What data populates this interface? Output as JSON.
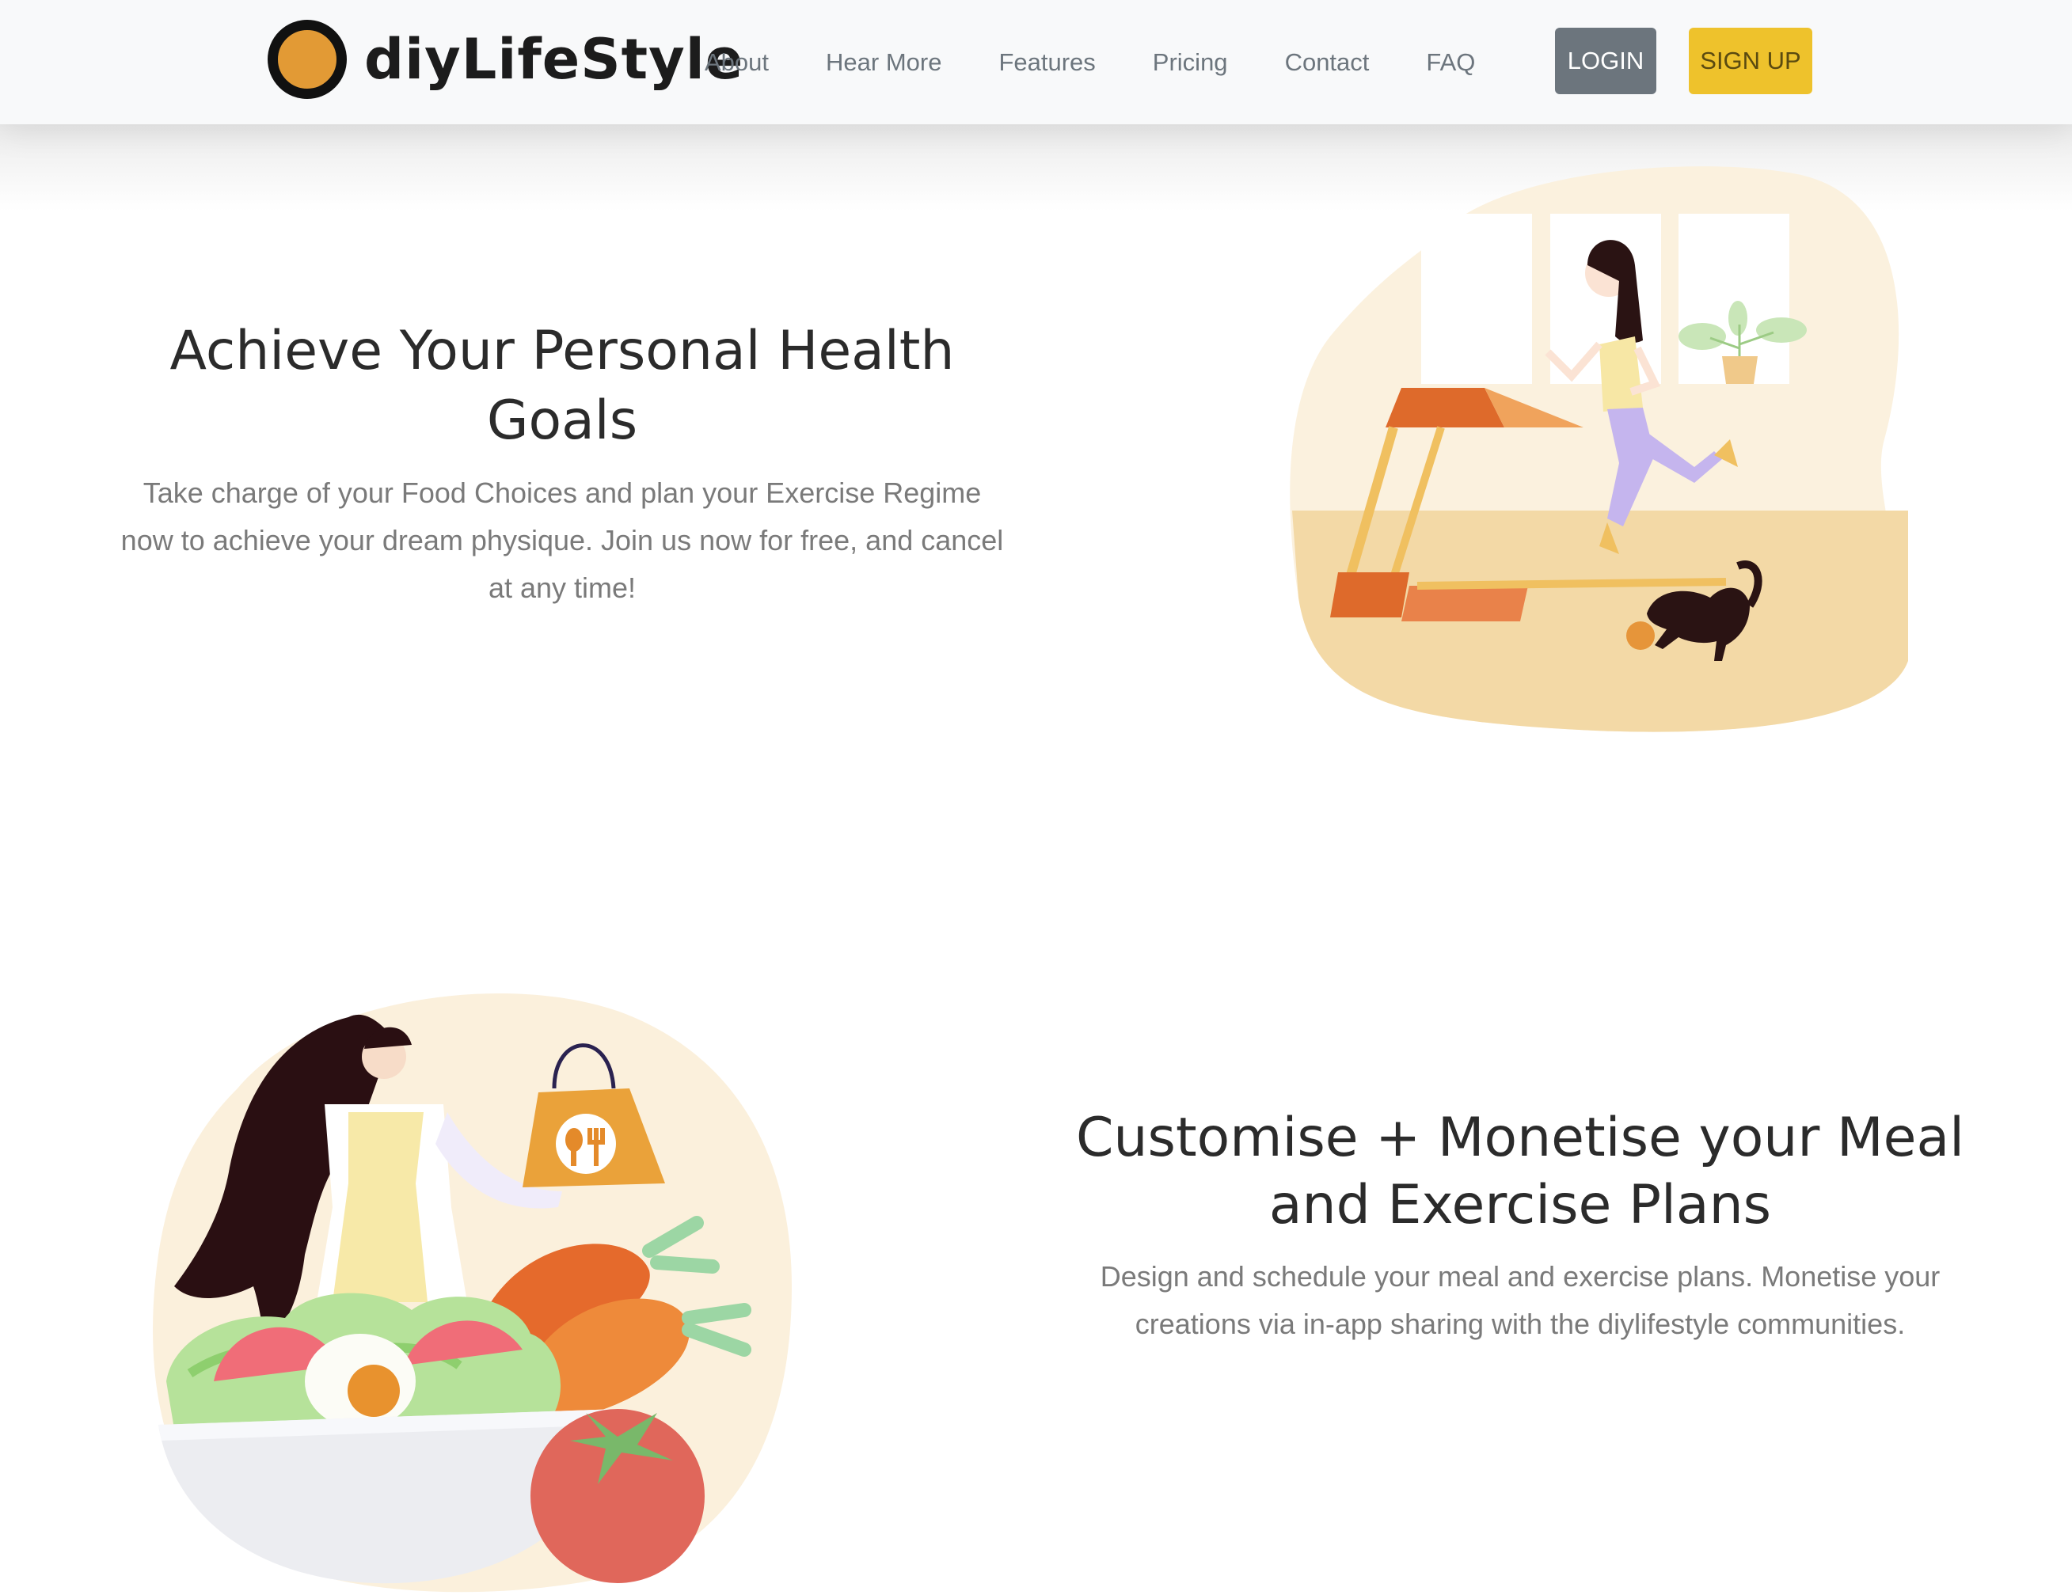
{
  "brand": {
    "name": "diyLifeStyle",
    "logo_color": "#e29a35"
  },
  "nav": {
    "links": [
      "About",
      "Hear More",
      "Features",
      "Pricing",
      "Contact",
      "FAQ"
    ],
    "login_label": "LOGIN",
    "signup_label": "SIGN UP"
  },
  "hero": {
    "title": "Achieve Your Personal Health Goals",
    "description": "Take charge of your Food Choices and plan your Exercise Regime now to achieve your dream physique. Join us now for free, and cancel at any time!",
    "illustration": "woman-on-treadmill-illustration"
  },
  "feature": {
    "title_line1": "Customise + Monetise your Meal",
    "title_line2": "and Exercise Plans",
    "description": "Design and schedule your meal and exercise plans. Monetise your creations via in-app sharing with the diylifestyle communities.",
    "illustration": "woman-with-salad-bowl-illustration"
  },
  "colors": {
    "navbar_bg": "#f8f9fa",
    "login_bg": "#6c757d",
    "signup_bg": "#eec22c",
    "heading": "#2b2b2b",
    "body_text": "#7a7a7a"
  }
}
